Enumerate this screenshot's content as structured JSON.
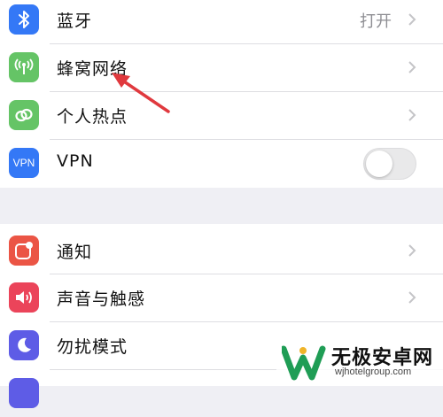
{
  "colors": {
    "bluetooth": "#3478f6",
    "cellular": "#65c466",
    "hotspot": "#65c466",
    "vpn": "#3478f6",
    "notifications": "#eb5545",
    "sounds": "#eb445a",
    "dnd": "#5e5ce6",
    "annotation_arrow": "#e0393e"
  },
  "settings_group_1": [
    {
      "label": "蓝牙",
      "value": "打开",
      "icon": "bluetooth-icon"
    },
    {
      "label": "蜂窝网络",
      "icon": "antenna-icon"
    },
    {
      "label": "个人热点",
      "icon": "chain-link-icon"
    },
    {
      "label": "VPN",
      "icon_text": "VPN",
      "toggle_on": false
    }
  ],
  "settings_group_2": [
    {
      "label": "通知",
      "icon": "notification-icon"
    },
    {
      "label": "声音与触感",
      "icon": "speaker-icon"
    },
    {
      "label": "勿扰模式",
      "icon": "moon-icon"
    }
  ],
  "watermark": {
    "title": "无极安卓网",
    "url": "wjhotelgroup.com"
  }
}
